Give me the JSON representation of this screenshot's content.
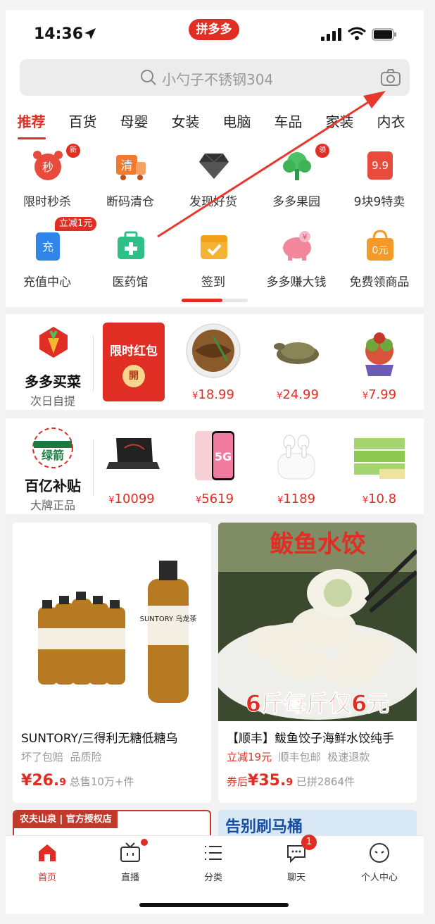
{
  "status": {
    "time": "14:36"
  },
  "app_logo": "拼多多",
  "search": {
    "placeholder": "小勺子不锈钢304"
  },
  "tabs": [
    "推荐",
    "百货",
    "母婴",
    "女装",
    "电脑",
    "车品",
    "家装",
    "内衣"
  ],
  "grid": [
    {
      "label": "限时秒杀",
      "icon": "alarm-clock-icon",
      "badge": "新",
      "color": "#e84b3c",
      "glyph": "秒"
    },
    {
      "label": "断码清仓",
      "icon": "truck-icon",
      "badge": "",
      "color": "#f07b2e",
      "glyph": "清"
    },
    {
      "label": "发现好货",
      "icon": "diamond-icon",
      "badge": "",
      "color": "#333333",
      "glyph": ""
    },
    {
      "label": "多多果园",
      "icon": "tree-icon",
      "badge": "领",
      "color": "#4cc063",
      "glyph": ""
    },
    {
      "label": "9块9特卖",
      "icon": "price-tag-icon",
      "badge": "",
      "color": "#e84b3c",
      "glyph": "9.9"
    },
    {
      "label": "充值中心",
      "icon": "phone-charge-icon",
      "badge": "立减1元",
      "color": "#2f86e8",
      "glyph": "充"
    },
    {
      "label": "医药馆",
      "icon": "medicine-box-icon",
      "badge": "",
      "color": "#2fc08a",
      "glyph": "+"
    },
    {
      "label": "签到",
      "icon": "calendar-check-icon",
      "badge": "",
      "color": "#f5b335",
      "glyph": "✓"
    },
    {
      "label": "多多赚大钱",
      "icon": "piggy-bank-icon",
      "badge": "",
      "color": "#f2869a",
      "glyph": "¥"
    },
    {
      "label": "免费领商品",
      "icon": "shopping-bag-icon",
      "badge": "",
      "color": "#f59a2a",
      "glyph": "0元"
    }
  ],
  "grocery": {
    "title": "多多买菜",
    "subtitle": "次日自提",
    "promo": {
      "label": "限时红包",
      "coin": "開"
    },
    "products": [
      {
        "price": "18.99",
        "icon": "eel-plate-image"
      },
      {
        "price": "24.99",
        "icon": "soft-shell-turtle-image"
      },
      {
        "price": "7.99",
        "icon": "succulent-plant-image"
      }
    ]
  },
  "subsidy": {
    "title": "百亿补贴",
    "subtitle": "大牌正品",
    "brand": "绿箭",
    "products": [
      {
        "price": "10099",
        "icon": "gaming-laptop-image"
      },
      {
        "price": "5619",
        "icon": "iphone-5g-image",
        "label": "5G"
      },
      {
        "price": "1189",
        "icon": "airpods-image"
      },
      {
        "price": "10.8",
        "icon": "tissue-pack-image"
      }
    ]
  },
  "feed": [
    {
      "title": "SUNTORY/三得利无糖低糖乌",
      "tags": [
        "坏了包赔",
        "品质险"
      ],
      "pre": "",
      "price": "26.",
      "price_dec": "9",
      "sold": "总售10万+件",
      "img_text": "SUNTORY 乌龙茶"
    },
    {
      "title": "【顺丰】鲅鱼饺子海鲜水饺纯手",
      "tags_hi": "立减19元",
      "tags": [
        "顺丰包邮",
        "极速退款"
      ],
      "pre": "券后",
      "price": "35.",
      "price_dec": "9",
      "sold": "已拼2864件",
      "img_top": "鲅鱼水饺",
      "img_bottom": "6斤每斤仅6元"
    }
  ],
  "peek": [
    {
      "text": "农夫山泉 | 官方授权店"
    },
    {
      "text": "告别刷马桶"
    }
  ],
  "tabbar": [
    {
      "label": "首页",
      "icon": "home-icon"
    },
    {
      "label": "直播",
      "icon": "tv-icon"
    },
    {
      "label": "分类",
      "icon": "list-icon"
    },
    {
      "label": "聊天",
      "icon": "chat-bubble-icon",
      "count": "1"
    },
    {
      "label": "个人中心",
      "icon": "profile-icon"
    }
  ]
}
